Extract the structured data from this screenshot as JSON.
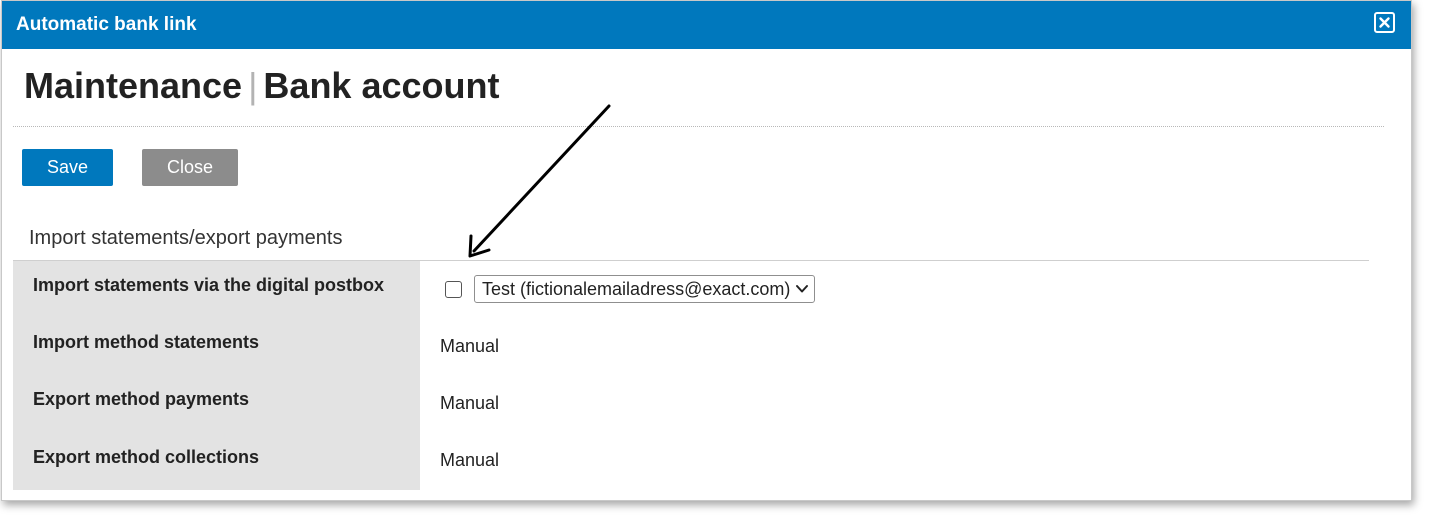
{
  "window": {
    "title": "Automatic bank link",
    "close_icon": "close-icon"
  },
  "heading": {
    "part1": "Maintenance",
    "separator": "|",
    "part2": "Bank account"
  },
  "toolbar": {
    "save_label": "Save",
    "close_label": "Close"
  },
  "section": {
    "title": "Import statements/export payments",
    "fields": [
      {
        "label": "Import statements via the digital postbox",
        "checked": false,
        "select_value": "Test (fictionalemailadress@exact.com)"
      },
      {
        "label": "Import method statements",
        "value": "Manual"
      },
      {
        "label": "Export method payments",
        "value": "Manual"
      },
      {
        "label": "Export method collections",
        "value": "Manual"
      }
    ]
  },
  "colors": {
    "titlebar": "#0078bd",
    "save_button": "#0078bd",
    "close_button": "#8c8c8c",
    "label_column": "#e3e3e3"
  }
}
